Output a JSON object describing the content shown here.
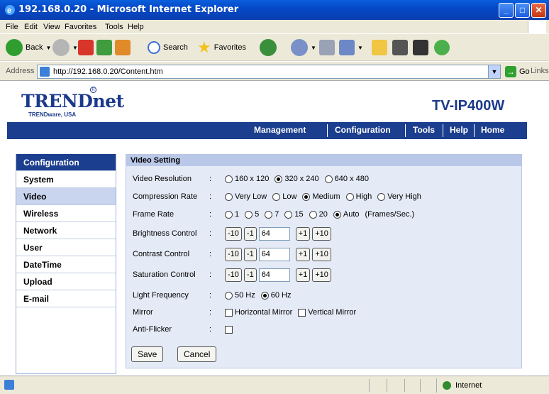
{
  "window": {
    "title": "192.168.0.20 - Microsoft Internet Explorer"
  },
  "menu": [
    "File",
    "Edit",
    "View",
    "Favorites",
    "Tools",
    "Help"
  ],
  "toolbar": {
    "back": "Back",
    "search": "Search",
    "favorites": "Favorites"
  },
  "address": {
    "label": "Address",
    "url": "http://192.168.0.20/Content.htm",
    "go": "Go",
    "links": "Links"
  },
  "header": {
    "brand": "TRENDnet",
    "brand_sub": "TRENDware, USA",
    "trademark": "R",
    "model": "TV-IP400W"
  },
  "nav": [
    "Management",
    "Configuration",
    "Tools",
    "Help",
    "Home"
  ],
  "sidebar": {
    "heading": "Configuration",
    "items": [
      "System",
      "Video",
      "Wireless",
      "Network",
      "User",
      "DateTime",
      "Upload",
      "E-mail"
    ],
    "active": "Video"
  },
  "panel": {
    "title": "Video Setting",
    "colon": ":",
    "resolution": {
      "label": "Video Resolution",
      "options": [
        "160 x 120",
        "320 x 240",
        "640 x 480"
      ],
      "selected": "320 x 240"
    },
    "compression": {
      "label": "Compression Rate",
      "options": [
        "Very Low",
        "Low",
        "Medium",
        "High",
        "Very High"
      ],
      "selected": "Medium"
    },
    "framerate": {
      "label": "Frame Rate",
      "options": [
        "1",
        "5",
        "7",
        "15",
        "20",
        "Auto"
      ],
      "selected": "Auto",
      "unit": "(Frames/Sec.)"
    },
    "brightness": {
      "label": "Brightness Control",
      "value": "64"
    },
    "contrast": {
      "label": "Contrast Control",
      "value": "64"
    },
    "saturation": {
      "label": "Saturation Control",
      "value": "64"
    },
    "steps": [
      "-10",
      "-1",
      "+1",
      "+10"
    ],
    "light": {
      "label": "Light Frequency",
      "options": [
        "50 Hz",
        "60 Hz"
      ],
      "selected": "60 Hz"
    },
    "mirror": {
      "label": "Mirror",
      "options": [
        "Horizontal Mirror",
        "Vertical Mirror"
      ]
    },
    "antiflicker": {
      "label": "Anti-Flicker"
    },
    "save": "Save",
    "cancel": "Cancel"
  },
  "status": {
    "zone": "Internet"
  },
  "colors": {
    "titlebar": "#0548c7",
    "nav": "#1c3e8e",
    "panel": "#e4eaf6",
    "panel_head": "#b9c8e8",
    "brand": "#1c3a8c"
  }
}
